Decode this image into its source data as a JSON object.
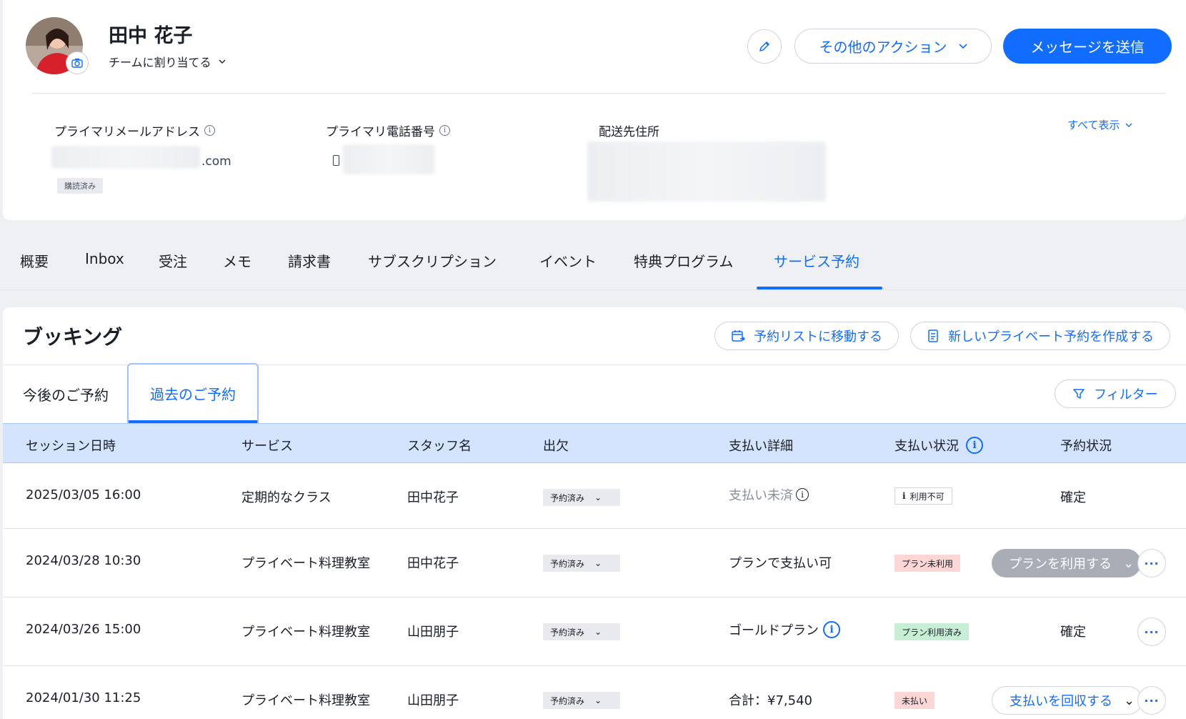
{
  "profile": {
    "name": "田中 花子",
    "assign_label": "チームに割り当てる",
    "more_actions_label": "その他のアクション",
    "send_message_label": "メッセージを送信"
  },
  "contact": {
    "email_label": "プライマリメールアドレス",
    "email_suffix": ".com",
    "subscribed_badge": "購読済み",
    "phone_label": "プライマリ電話番号",
    "address_label": "配送先住所",
    "see_all_label": "すべて表示"
  },
  "tabs": [
    {
      "label": "概要"
    },
    {
      "label": "Inbox"
    },
    {
      "label": "受注"
    },
    {
      "label": "メモ"
    },
    {
      "label": "請求書"
    },
    {
      "label": "サブスクリプション"
    },
    {
      "label": "イベント"
    },
    {
      "label": "特典プログラム"
    },
    {
      "label": "サービス予約"
    }
  ],
  "bookings": {
    "title": "ブッキング",
    "goto_list_label": "予約リストに移動する",
    "new_private_label": "新しいプライベート予約を作成する",
    "upcoming_tab": "今後のご予約",
    "past_tab": "過去のご予約",
    "filter_label": "フィルター",
    "columns": [
      "セッション日時",
      "サービス",
      "スタッフ名",
      "出欠",
      "支払い詳細",
      "支払い状況",
      "予約状況"
    ],
    "rows": [
      {
        "datetime": "2025/03/05 16:00",
        "service": "定期的なクラス",
        "staff": "田中花子",
        "attendance": "予約済み",
        "payment_detail": "支払い未済",
        "payment_status": "利用不可",
        "booking_status": "確定"
      },
      {
        "datetime": "2024/03/28 10:30",
        "service": "プライベート料理教室",
        "staff": "田中花子",
        "attendance": "予約済み",
        "payment_detail": "プランで支払い可",
        "payment_status": "プラン未利用",
        "action": "プランを利用する",
        "more": "···"
      },
      {
        "datetime": "2024/03/26 15:00",
        "service": "プライベート料理教室",
        "staff": "山田朋子",
        "attendance": "予約済み",
        "payment_detail": "ゴールドプラン",
        "payment_status": "プラン利用済み",
        "booking_status": "確定",
        "more": "···"
      },
      {
        "datetime": "2024/01/30 11:25",
        "service": "プライベート料理教室",
        "staff": "山田朋子",
        "attendance": "予約済み",
        "payment_detail": "合計：¥7,540",
        "payment_status": "未払い",
        "action": "支払いを回収する",
        "more": "···"
      }
    ]
  },
  "colors": {
    "accent": "#116dff",
    "header_row": "#d4e4fe",
    "badge_red": "#fdd6d6",
    "badge_green": "#c8efd6"
  }
}
